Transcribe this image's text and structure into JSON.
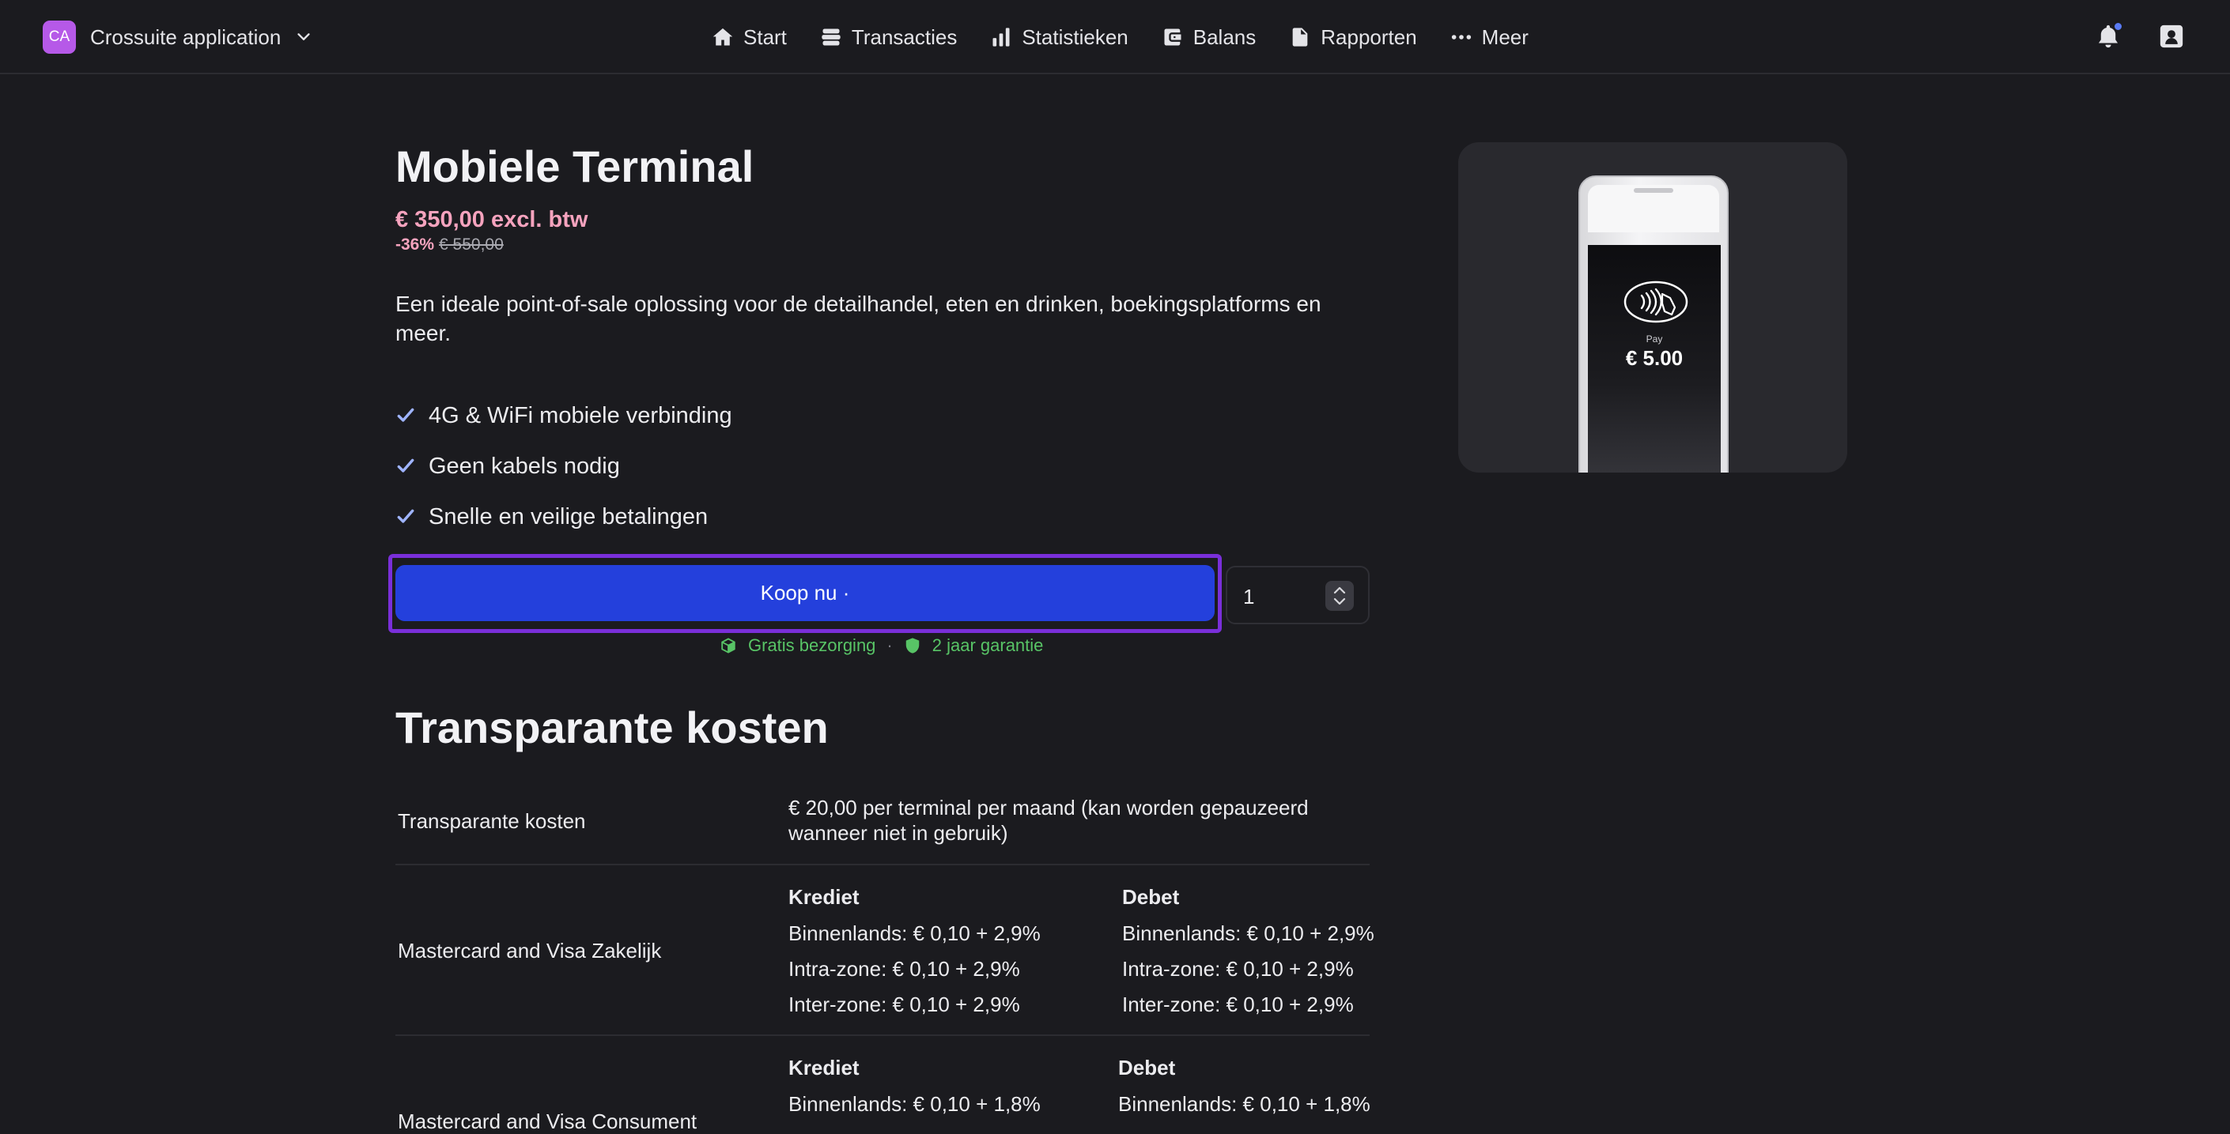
{
  "app": {
    "avatar_initials": "CA",
    "name": "Crossuite application"
  },
  "nav": [
    {
      "label": "Start",
      "icon": "home-icon"
    },
    {
      "label": "Transacties",
      "icon": "stack-icon"
    },
    {
      "label": "Statistieken",
      "icon": "bar-chart-icon"
    },
    {
      "label": "Balans",
      "icon": "wallet-icon"
    },
    {
      "label": "Rapporten",
      "icon": "document-icon"
    },
    {
      "label": "Meer",
      "icon": "more-dots-icon"
    }
  ],
  "product": {
    "title": "Mobiele Terminal",
    "price": "€ 350,00 excl. btw",
    "discount_pct": "-36%",
    "old_price": "€ 550,00",
    "description": "Een ideale point-of-sale oplossing voor de detailhandel, eten en drinken, boekingsplatforms en meer.",
    "features": [
      "4G & WiFi mobiele verbinding",
      "Geen kabels nodig",
      "Snelle en veilige betalingen"
    ],
    "buy_label": "Koop nu ·",
    "quantity": "1",
    "perk_delivery": "Gratis bezorging",
    "perk_separator": "·",
    "perk_warranty": "2 jaar garantie",
    "image": {
      "pay_label": "Pay",
      "pay_amount": "€ 5.00"
    }
  },
  "costs": {
    "heading": "Transparante kosten",
    "rows": [
      {
        "label": "Transparante kosten",
        "text": "€ 20,00 per terminal per maand (kan worden gepauzeerd wanneer niet in gebruik)"
      },
      {
        "label": "Mastercard and Visa Zakelijk",
        "credit": {
          "heading": "Krediet",
          "lines": [
            "Binnenlands: € 0,10 + 2,9%",
            "Intra-zone: € 0,10 + 2,9%",
            "Inter-zone: € 0,10 + 2,9%"
          ]
        },
        "debit": {
          "heading": "Debet",
          "lines": [
            "Binnenlands: € 0,10 + 2,9%",
            "Intra-zone: € 0,10 + 2,9%",
            "Inter-zone: € 0,10 + 2,9%"
          ]
        }
      },
      {
        "label": "Mastercard and Visa Consument",
        "credit": {
          "heading": "Krediet",
          "lines": [
            "Binnenlands: € 0,10 + 1,8%"
          ]
        },
        "debit": {
          "heading": "Debet",
          "lines": [
            "Binnenlands: € 0,10 + 1,8%"
          ]
        }
      }
    ]
  }
}
